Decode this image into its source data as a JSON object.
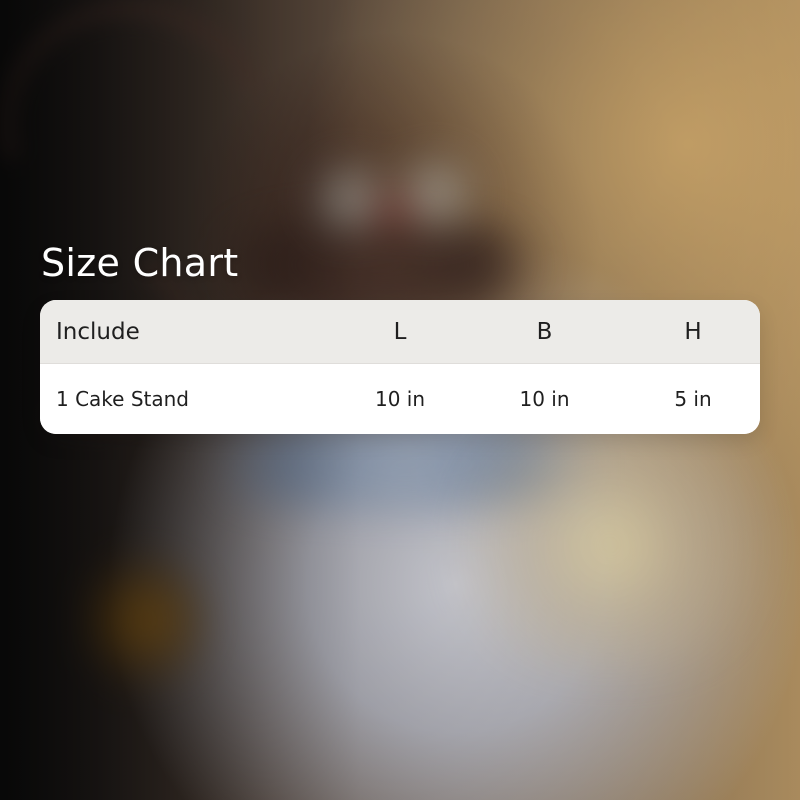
{
  "size_chart": {
    "title": "Size Chart",
    "columns": [
      "Include",
      "L",
      "B",
      "H"
    ],
    "rows": [
      {
        "include": "1 Cake Stand",
        "l": "10 in",
        "b": "10 in",
        "h": "5 in"
      }
    ]
  }
}
